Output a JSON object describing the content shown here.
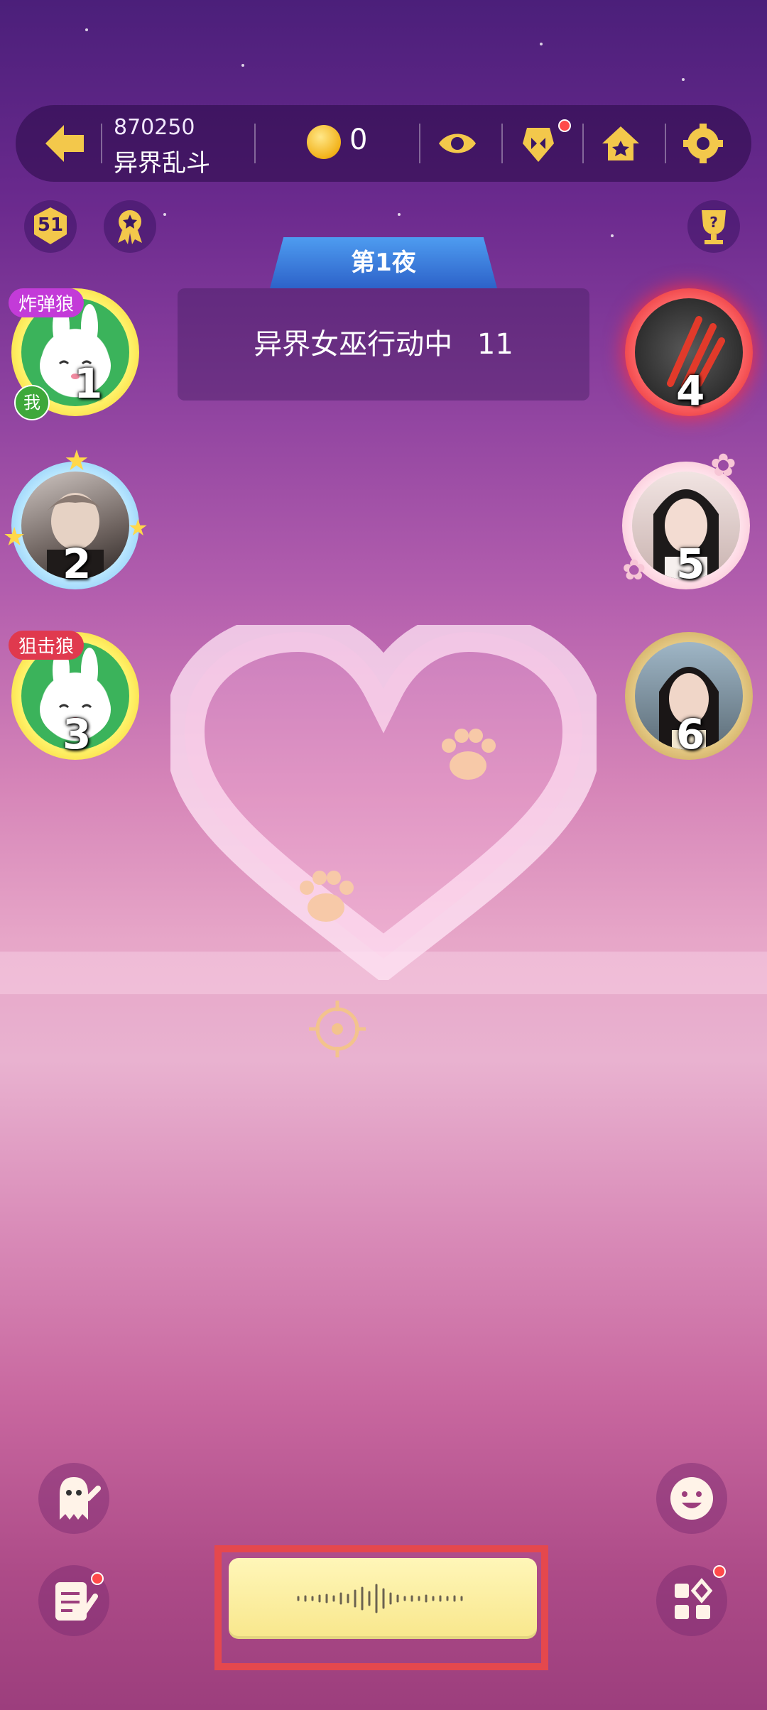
{
  "topbar": {
    "room_id": "870250",
    "room_name": "异界乱斗",
    "coin_count": "0",
    "icons": [
      "back-arrow-icon",
      "coin-icon",
      "eye-icon",
      "wolf-card-icon",
      "home-icon",
      "gear-icon"
    ]
  },
  "left_badges": {
    "level": "51"
  },
  "night": {
    "label": "第1夜"
  },
  "status": {
    "text": "异界女巫行动中",
    "countdown": "11"
  },
  "players": [
    {
      "seat": "1",
      "role_tag": "炸弹狼",
      "me_tag": "我"
    },
    {
      "seat": "2"
    },
    {
      "seat": "3",
      "role_tag": "狙击狼"
    },
    {
      "seat": "4"
    },
    {
      "seat": "5"
    },
    {
      "seat": "6"
    }
  ],
  "colors": {
    "accent_yellow": "#f8e78c",
    "highlight_red": "#e5484d",
    "night_tab_blue": "#3f7fe0"
  }
}
